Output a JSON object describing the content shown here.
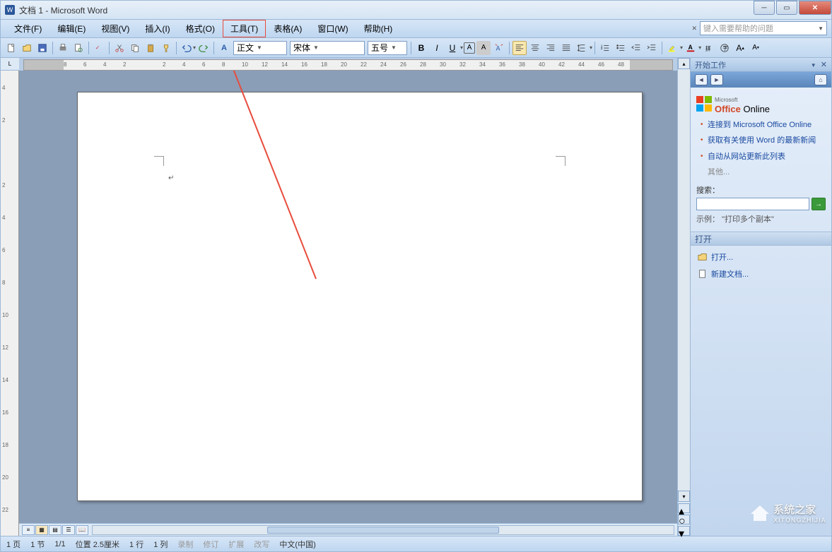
{
  "title": "文档 1 - Microsoft Word",
  "menus": {
    "file": "文件(F)",
    "edit": "编辑(E)",
    "view": "视图(V)",
    "insert": "插入(I)",
    "format": "格式(O)",
    "tools": "工具(T)",
    "table": "表格(A)",
    "window": "窗口(W)",
    "help": "帮助(H)"
  },
  "help_placeholder": "键入需要帮助的问题",
  "formatting": {
    "style": "正文",
    "font": "宋体",
    "size": "五号"
  },
  "ruler_h": [
    "8",
    "6",
    "4",
    "2",
    "",
    "2",
    "4",
    "6",
    "8",
    "10",
    "12",
    "14",
    "16",
    "18",
    "20",
    "22",
    "24",
    "26",
    "28",
    "30",
    "32",
    "34",
    "36",
    "38",
    "40",
    "42",
    "44",
    "46",
    "48"
  ],
  "ruler_v": [
    "4",
    "2",
    "",
    "2",
    "4",
    "6",
    "8",
    "10",
    "12",
    "14",
    "16",
    "18",
    "20",
    "22"
  ],
  "taskpane": {
    "title": "开始工作",
    "office_brand_small": "Microsoft",
    "office_brand": "Office Online",
    "links": {
      "connect": "连接到 Microsoft Office Online",
      "news": "获取有关使用 Word 的最新新闻",
      "update": "自动从网站更新此列表",
      "other": "其他..."
    },
    "search_label": "搜索：",
    "example_label": "示例：",
    "example_text": "\"打印多个副本\"",
    "open_section": "打开",
    "open_link": "打开...",
    "new_doc": "新建文档..."
  },
  "status": {
    "page": "1 页",
    "section": "1 节",
    "pages": "1/1",
    "position": "位置 2.5厘米",
    "line": "1 行",
    "column": "1 列",
    "rec": "录制",
    "rev": "修订",
    "ext": "扩展",
    "ovr": "改写",
    "lang": "中文(中国)"
  },
  "watermark": {
    "text": "系统之家",
    "sub": "XITONGZHIJIA"
  }
}
